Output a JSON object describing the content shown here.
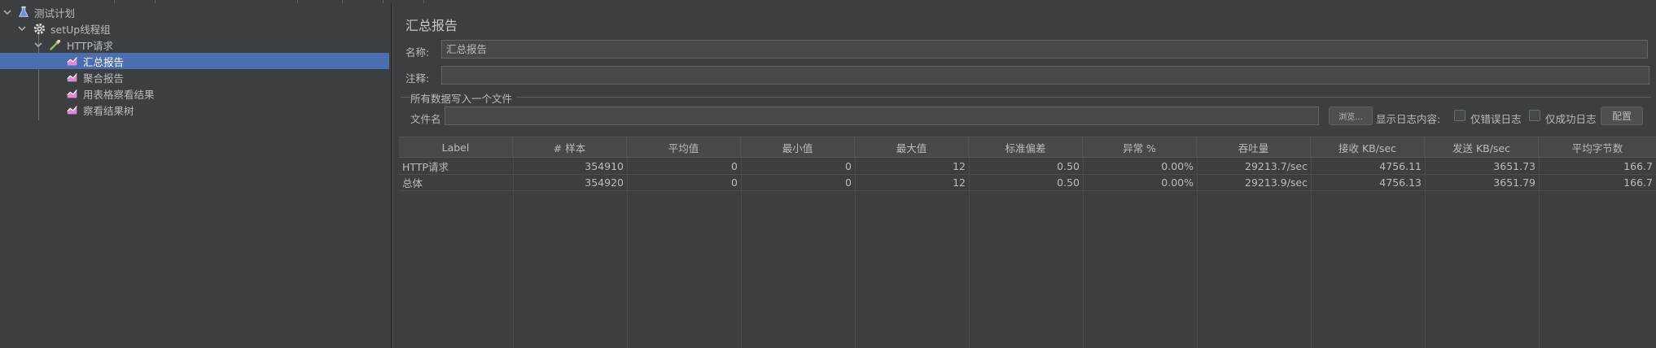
{
  "tree": {
    "items": [
      {
        "label": "测试计划",
        "icon": "flask-icon"
      },
      {
        "label": "setUp线程组",
        "icon": "gear-icon"
      },
      {
        "label": "HTTP请求",
        "icon": "pipette-icon"
      },
      {
        "label": "汇总报告",
        "icon": "chart-icon",
        "selected": true
      },
      {
        "label": "聚合报告",
        "icon": "chart-icon"
      },
      {
        "label": "用表格察看结果",
        "icon": "chart-icon"
      },
      {
        "label": "察看结果树",
        "icon": "chart-icon"
      }
    ]
  },
  "panel": {
    "title": "汇总报告",
    "name_label": "名称:",
    "name_value": "汇总报告",
    "comment_label": "注释:",
    "comment_value": "",
    "group_title": "所有数据写入一个文件",
    "file_label": "文件名",
    "file_value": "",
    "browse_label": "浏览...",
    "log_label": "显示日志内容:",
    "errors_only_label": "仅错误日志",
    "success_only_label": "仅成功日志",
    "config_label": "配置"
  },
  "table": {
    "headers": [
      "Label",
      "# 样本",
      "平均值",
      "最小值",
      "最大值",
      "标准偏差",
      "异常 %",
      "吞吐量",
      "接收 KB/sec",
      "发送 KB/sec",
      "平均字节数"
    ],
    "rows": [
      [
        "HTTP请求",
        "354910",
        "0",
        "0",
        "12",
        "0.50",
        "0.00%",
        "29213.7/sec",
        "4756.11",
        "3651.73",
        "166.7"
      ],
      [
        "总体",
        "354920",
        "0",
        "0",
        "12",
        "0.50",
        "0.00%",
        "29213.9/sec",
        "4756.13",
        "3651.79",
        "166.7"
      ]
    ]
  },
  "colors": {
    "background": "#3c3f41",
    "selection": "#4b6eaf",
    "text": "#bbbbbb"
  }
}
